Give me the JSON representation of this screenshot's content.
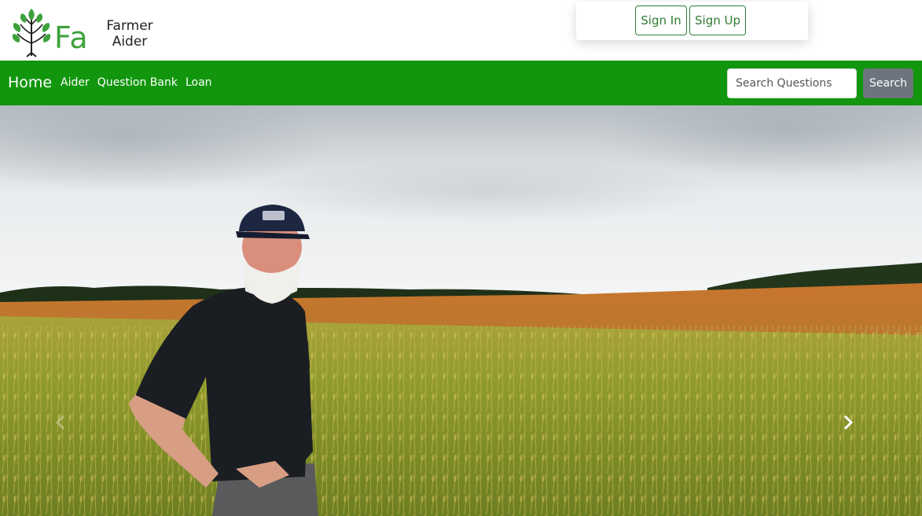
{
  "header": {
    "logo_letters": "Fa",
    "logo_line1": "Farmer",
    "logo_line2": "Aider",
    "sign_in_label": "Sign In",
    "sign_up_label": "Sign Up"
  },
  "nav": {
    "brand": "Home",
    "links": [
      "Aider",
      "Question Bank",
      "Loan"
    ],
    "search_placeholder": "Search Questions",
    "search_value": "",
    "search_button": "Search"
  },
  "colors": {
    "nav_green": "#12960e",
    "logo_green": "#3ea23c",
    "button_outline": "#2e7d32",
    "search_button": "#6c757d"
  },
  "icons": {
    "logo": "wheat-tree-icon",
    "prev": "chevron-left-icon",
    "next": "chevron-right-icon"
  }
}
